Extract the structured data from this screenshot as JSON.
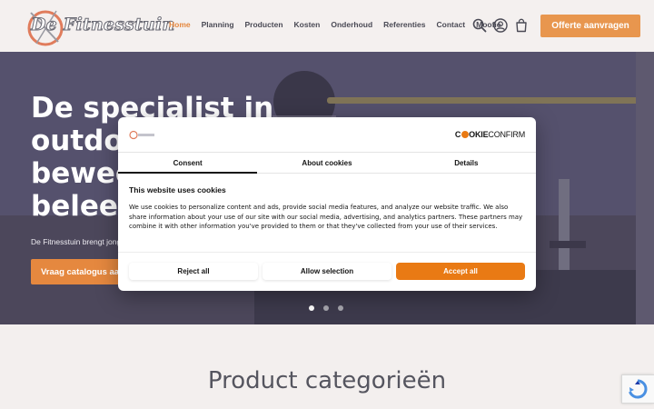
{
  "header": {
    "logo_text": "De Fitnesstuin",
    "nav": [
      {
        "label": "Home",
        "active": true
      },
      {
        "label": "Planning",
        "active": false
      },
      {
        "label": "Producten",
        "active": false
      },
      {
        "label": "Kosten",
        "active": false
      },
      {
        "label": "Onderhoud",
        "active": false
      },
      {
        "label": "Referenties",
        "active": false
      },
      {
        "label": "Contact",
        "active": false
      },
      {
        "label": "Moofie",
        "active": false
      }
    ],
    "icons": [
      "search-icon",
      "user-icon",
      "cart-icon"
    ],
    "cta_label": "Offerte aanvragen"
  },
  "hero": {
    "title_lines": [
      "De specialist in",
      "outdoor",
      "bewee",
      "beleeft"
    ],
    "subtitle": "De Fitnesstuin brengt jong",
    "button_label": "Vraag catalogus aan",
    "slides_total": 3,
    "slide_active": 1
  },
  "section": {
    "title": "Product categorieën"
  },
  "cookie_dialog": {
    "brand_part1": "C",
    "brand_part2": "OKIE",
    "brand_part3": "CONFIRM",
    "tabs": [
      {
        "label": "Consent",
        "active": true
      },
      {
        "label": "About cookies",
        "active": false
      },
      {
        "label": "Details",
        "active": false
      }
    ],
    "heading": "This website uses cookies",
    "body": "We use cookies to personalize content and ads, provide social media features, and analyze our website traffic. We also share information about your use of our site with our social media, advertising, and analytics partners. These partners may combine it with other information you've provided to them or that they've collected from your use of their services.",
    "buttons": {
      "reject": "Reject all",
      "allow_selection": "Allow selection",
      "accept": "Accept all"
    }
  },
  "colors": {
    "accent": "#e5883f",
    "accept_button": "#e97a14",
    "text_dark": "#141414",
    "nav_text": "#4a4a55"
  }
}
